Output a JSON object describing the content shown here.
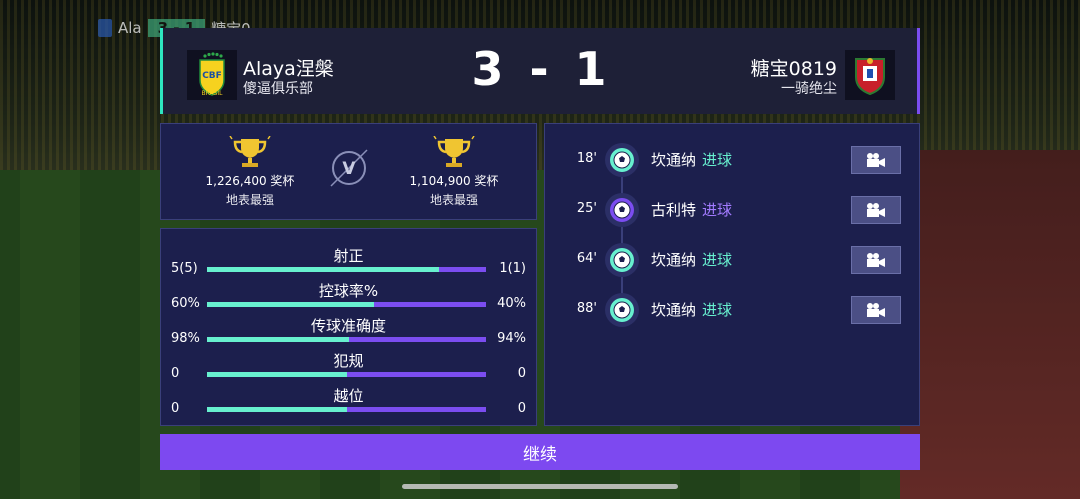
{
  "mini_scoreboard": {
    "home": "Ala",
    "score": "3 - 1",
    "away": "糖宝0"
  },
  "header": {
    "home": {
      "name": "Alaya涅槃",
      "club": "傻逼俱乐部",
      "crest_text": "BRASIL"
    },
    "away": {
      "name": "糖宝0819",
      "club": "一骑绝尘"
    },
    "score_home": "3",
    "score_sep": "-",
    "score_away": "1"
  },
  "trophies": {
    "home": {
      "value": "1,226,400 奖杯",
      "rank": "地表最强"
    },
    "away": {
      "value": "1,104,900 奖杯",
      "rank": "地表最强"
    },
    "vs": "V"
  },
  "stats": [
    {
      "label": "射正",
      "home": "5(5)",
      "away": "1(1)",
      "home_share": 0.83
    },
    {
      "label": "控球率%",
      "home": "60%",
      "away": "40%",
      "home_share": 0.6
    },
    {
      "label": "传球准确度",
      "home": "98%",
      "away": "94%",
      "home_share": 0.51
    },
    {
      "label": "犯规",
      "home": "0",
      "away": "0",
      "home_share": 0.5
    },
    {
      "label": "越位",
      "home": "0",
      "away": "0",
      "home_share": 0.5
    }
  ],
  "events": [
    {
      "minute": "18'",
      "player": "坎通纳",
      "type": "进球",
      "team": "home"
    },
    {
      "minute": "25'",
      "player": "古利特",
      "type": "进球",
      "team": "away"
    },
    {
      "minute": "64'",
      "player": "坎通纳",
      "type": "进球",
      "team": "home"
    },
    {
      "minute": "88'",
      "player": "坎通纳",
      "type": "进球",
      "team": "home"
    }
  ],
  "continue_label": "继续",
  "colors": {
    "home_accent": "#67f0cf",
    "away_accent": "#7b4df0",
    "panel": "#1c1f4d",
    "button": "#7d49f0"
  },
  "icons": {
    "trophy": "trophy-icon",
    "ball": "soccer-ball-icon",
    "camera": "video-camera-icon",
    "vs": "versus-icon"
  }
}
